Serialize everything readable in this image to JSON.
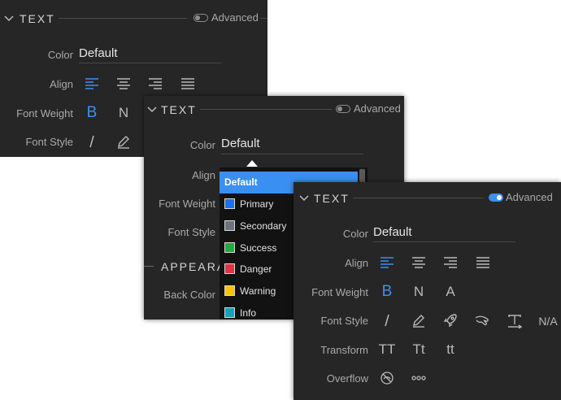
{
  "panel1": {
    "section_title": "TEXT",
    "advanced_label": "Advanced",
    "color_label": "Color",
    "color_value": "Default",
    "align_label": "Align",
    "font_weight_label": "Font Weight",
    "font_style_label": "Font Style",
    "weight_b": "B",
    "weight_n": "N"
  },
  "panel2": {
    "section_title": "TEXT",
    "advanced_label": "Advanced",
    "color_label": "Color",
    "color_value": "Default",
    "align_label": "Align",
    "font_weight_label": "Font Weight",
    "font_style_label": "Font Style",
    "appearance_title": "APPEARA",
    "back_color_label": "Back Color",
    "dropdown": {
      "items": [
        {
          "label": "Default",
          "color": "",
          "selected": true
        },
        {
          "label": "Primary",
          "color": "#1a73e8"
        },
        {
          "label": "Secondary",
          "color": "#6c757d"
        },
        {
          "label": "Success",
          "color": "#28a745"
        },
        {
          "label": "Danger",
          "color": "#dc3545"
        },
        {
          "label": "Warning",
          "color": "#ffc107"
        },
        {
          "label": "Info",
          "color": "#17a2b8"
        }
      ]
    }
  },
  "panel3": {
    "section_title": "TEXT",
    "advanced_label": "Advanced",
    "advanced_on": true,
    "color_label": "Color",
    "color_value": "Default",
    "align_label": "Align",
    "font_weight_label": "Font Weight",
    "weight_options": [
      "B",
      "N",
      "A"
    ],
    "font_style_label": "Font Style",
    "style_na": "N/A",
    "transform_label": "Transform",
    "transform_options": [
      "TT",
      "Tt",
      "tt"
    ],
    "overflow_label": "Overflow"
  },
  "colors": {
    "panel_bg": "#262626",
    "accent": "#3f8ef0",
    "dropdown_bg": "#121212",
    "dropdown_selected": "#3a8ff2"
  }
}
